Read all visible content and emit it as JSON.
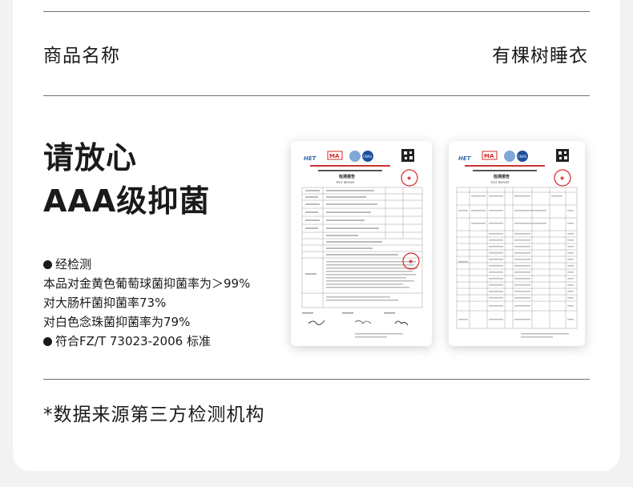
{
  "product": {
    "label": "商品名称",
    "value": "有棵树睡衣"
  },
  "headline": {
    "line1": "请放心",
    "line2": "AAA级抑菌"
  },
  "bullets": {
    "tested_label": "经检测",
    "lines": [
      "本品对金黄色葡萄球菌抑菌率为＞99%",
      "对大肠杆菌抑菌率73%",
      "对白色念珠菌抑菌率为79%"
    ],
    "standard": "符合FZ/T 73023-2006 标准"
  },
  "reports": {
    "report1_title": "检测报告",
    "report1_subtitle": "TEST REPORT",
    "report2_title": "检测报告",
    "report2_subtitle": "TEST REPORT",
    "logos": [
      "MA",
      "CNAS"
    ],
    "logo_colors": {
      "ma": "#d62828",
      "cnas": "#1f4e9c",
      "stamp": "#d62828"
    }
  },
  "footnote": "*数据来源第三方检测机构"
}
